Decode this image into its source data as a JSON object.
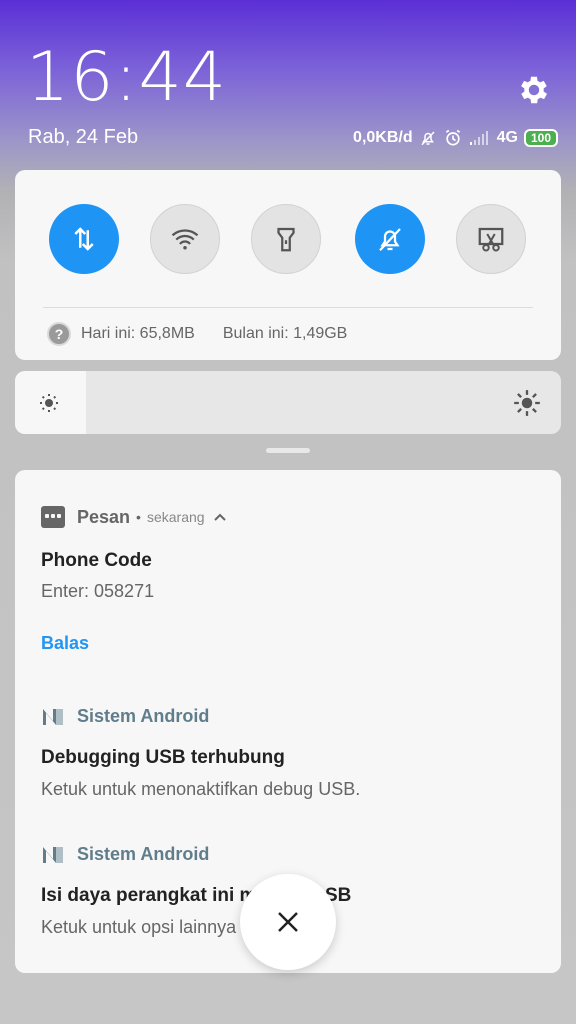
{
  "header": {
    "time": "16:44",
    "date": "Rab, 24 Feb",
    "net_speed": "0,0KB/d",
    "network": "4G",
    "battery": "100",
    "icons": [
      "settings-gear-icon",
      "silent-bell-icon",
      "alarm-clock-icon",
      "signal-bars-icon"
    ]
  },
  "quick_settings": {
    "toggles": [
      {
        "name": "mobile-data-toggle",
        "icon": "data-arrows-icon",
        "active": true
      },
      {
        "name": "wifi-toggle",
        "icon": "wifi-icon",
        "active": false
      },
      {
        "name": "flashlight-toggle",
        "icon": "flashlight-icon",
        "active": false
      },
      {
        "name": "silent-toggle",
        "icon": "bell-off-icon",
        "active": true
      },
      {
        "name": "screenshot-toggle",
        "icon": "scissors-screenshot-icon",
        "active": false
      }
    ],
    "usage_today": "Hari ini: 65,8MB",
    "usage_month": "Bulan ini: 1,49GB",
    "accent_color": "#1e95f5"
  },
  "brightness": {
    "level": 0.13
  },
  "notifications": [
    {
      "app": "Pesan",
      "time": "sekarang",
      "title": "Phone Code",
      "text": "Enter: 058271",
      "action": "Balas"
    },
    {
      "app": "Sistem Android",
      "title": "Debugging USB terhubung",
      "text": "Ketuk untuk menonaktifkan debug USB."
    },
    {
      "app": "Sistem Android",
      "title": "Isi daya perangkat ini m",
      "title_end": "SB",
      "text": "Ketuk untuk opsi lainnya"
    }
  ],
  "close_button": {
    "icon": "close-x-icon"
  }
}
